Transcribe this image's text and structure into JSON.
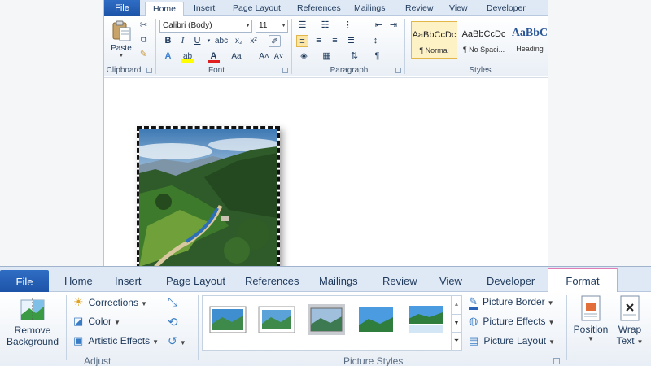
{
  "top": {
    "tabs": [
      "File",
      "Home",
      "Insert",
      "Page Layout",
      "References",
      "Mailings",
      "Review",
      "View",
      "Developer"
    ],
    "clipboard": {
      "paste_label": "Paste",
      "group_label": "Clipboard"
    },
    "font": {
      "name": "Calibri (Body)",
      "size": "11",
      "group_label": "Font"
    },
    "paragraph": {
      "group_label": "Paragraph"
    },
    "styles": {
      "group_label": "Styles",
      "items": [
        {
          "sample": "AaBbCcDc",
          "name": "¶ Normal"
        },
        {
          "sample": "AaBbCcDc",
          "name": "¶ No Spaci..."
        },
        {
          "sample": "AaBbC",
          "name": "Heading"
        }
      ]
    }
  },
  "bottom": {
    "tabs": [
      "File",
      "Home",
      "Insert",
      "Page Layout",
      "References",
      "Mailings",
      "Review",
      "View",
      "Developer",
      "Format"
    ],
    "remove_background": {
      "line1": "Remove",
      "line2": "Background"
    },
    "adjust": {
      "group_label": "Adjust",
      "corrections": "Corrections",
      "color": "Color",
      "artistic_effects": "Artistic Effects"
    },
    "picture_styles": {
      "group_label": "Picture Styles",
      "picture_border": "Picture Border",
      "picture_effects": "Picture Effects",
      "picture_layout": "Picture Layout"
    },
    "arrange": {
      "position": "Position",
      "wrap_line1": "Wrap",
      "wrap_line2": "Text"
    }
  },
  "colors": {
    "file_tab": "#2a63b8",
    "format_accent": "#e37cb6",
    "ribbon_text": "#1e395b"
  }
}
